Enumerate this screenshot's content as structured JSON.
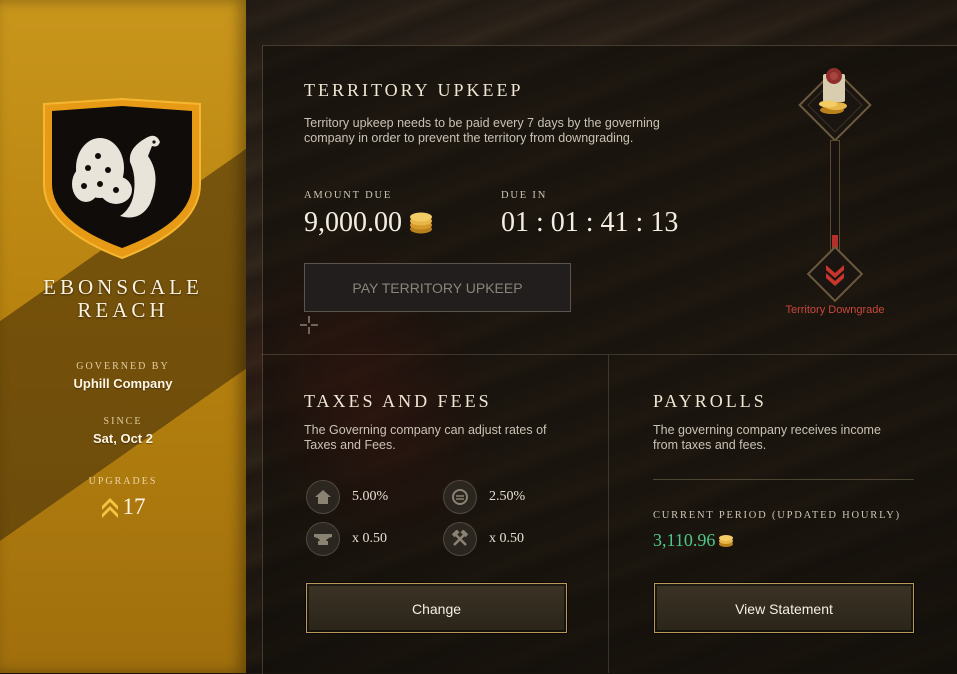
{
  "sidebar": {
    "territory_name_line1": "EBONSCALE",
    "territory_name_line2": "REACH",
    "governed_by_label": "GOVERNED BY",
    "governed_by_value": "Uphill Company",
    "since_label": "SINCE",
    "since_value": "Sat, Oct 2",
    "upgrades_label": "UPGRADES",
    "upgrades_value": "17"
  },
  "upkeep": {
    "title": "TERRITORY UPKEEP",
    "description_line1": "Territory upkeep needs to be paid every 7 days by the governing",
    "description_line2": "company in order to prevent the territory from downgrading.",
    "amount_due_label": "AMOUNT DUE",
    "amount_due_value": "9,000.00",
    "due_in_label": "DUE IN",
    "due_in_value": "01 : 01 : 41 : 13",
    "pay_button_label": "PAY TERRITORY UPKEEP",
    "downgrade_label": "Territory Downgrade",
    "downgrade_progress": 0.18
  },
  "taxes": {
    "title": "TAXES AND FEES",
    "description_line1": "The Governing company can adjust rates of",
    "description_line2": "Taxes and Fees.",
    "items": [
      {
        "icon": "house-icon",
        "value": "5.00%"
      },
      {
        "icon": "coins-swap-icon",
        "value": "2.50%"
      },
      {
        "icon": "anvil-icon",
        "value": "x 0.50"
      },
      {
        "icon": "crossed-hammers-icon",
        "value": "x 0.50"
      }
    ],
    "change_button_label": "Change"
  },
  "payrolls": {
    "title": "PAYROLLS",
    "description_line1": "The governing company receives income",
    "description_line2": "from taxes and fees.",
    "period_label": "CURRENT PERIOD (UPDATED HOURLY)",
    "period_value": "3,110.96",
    "statement_button_label": "View Statement"
  },
  "colors": {
    "sidebar_gold": "#b8830f",
    "income_green": "#4cc98a",
    "downgrade_red": "#c9483d"
  }
}
